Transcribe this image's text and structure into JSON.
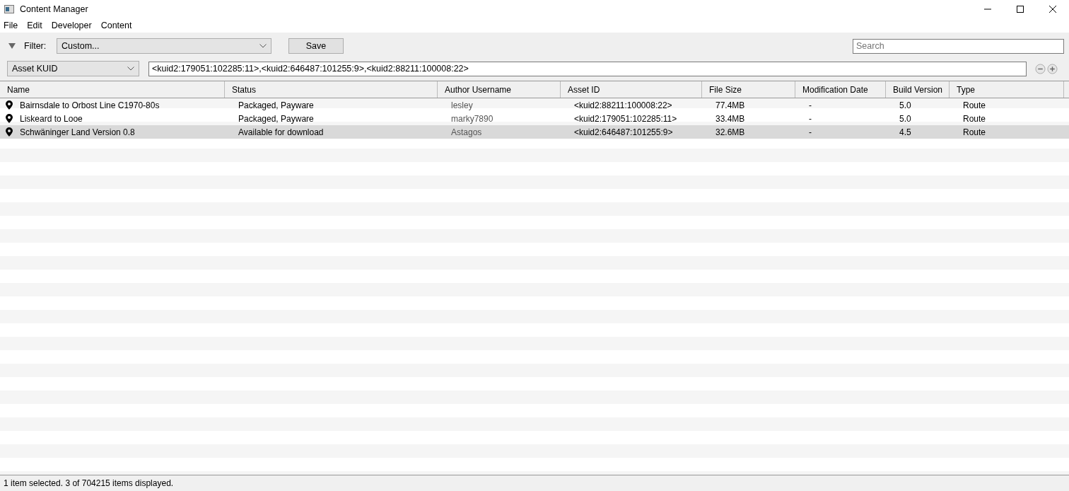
{
  "window": {
    "title": "Content Manager"
  },
  "menu": [
    "File",
    "Edit",
    "Developer",
    "Content"
  ],
  "filter": {
    "label": "Filter:",
    "value": "Custom...",
    "save": "Save",
    "search_placeholder": "Search"
  },
  "criteria": {
    "field": "Asset KUID",
    "value": "<kuid2:179051:102285:11>,<kuid2:646487:101255:9>,<kuid2:88211:100008:22>"
  },
  "table": {
    "columns": [
      "Name",
      "Status",
      "Author Username",
      "Asset ID",
      "File Size",
      "Modification Date",
      "Build Version",
      "Type"
    ],
    "rows": [
      {
        "selected": false,
        "cells": [
          "Bairnsdale to Orbost Line C1970-80s",
          "Packaged, Payware",
          "lesley",
          "<kuid2:88211:100008:22>",
          "77.4MB",
          "-",
          "5.0",
          "Route"
        ]
      },
      {
        "selected": false,
        "cells": [
          "Liskeard to Looe",
          "Packaged, Payware",
          "marky7890",
          "<kuid2:179051:102285:11>",
          "33.4MB",
          "-",
          "5.0",
          "Route"
        ]
      },
      {
        "selected": true,
        "cells": [
          "Schwäninger Land Version 0.8",
          "Available for download",
          "Astagos",
          "<kuid2:646487:101255:9>",
          "32.6MB",
          "-",
          "4.5",
          "Route"
        ]
      }
    ]
  },
  "status_bar": "1 item selected. 3 of 704215 items displayed."
}
